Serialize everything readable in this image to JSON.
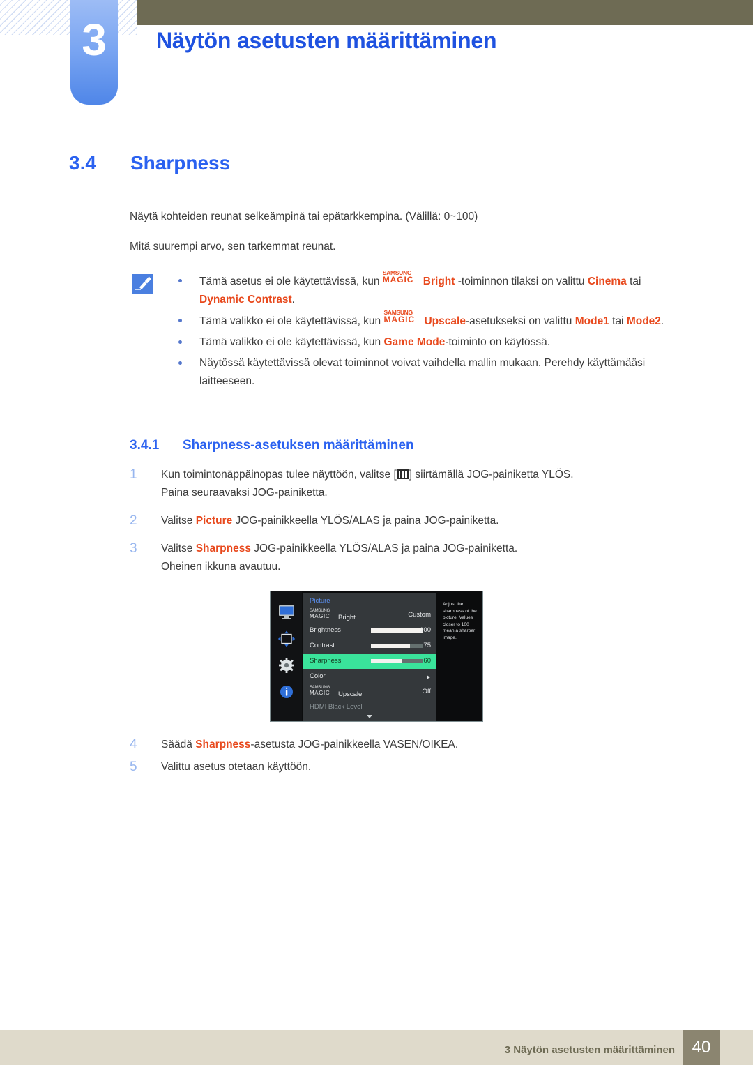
{
  "header": {
    "chapter_number": "3",
    "chapter_title": "Näytön asetusten määrittäminen",
    "hatch_icon": "diagonal-hatch-decoration",
    "olive_color": "#6e6b54",
    "tab_color": "#4f86e8"
  },
  "section": {
    "number": "3.4",
    "title": "Sharpness",
    "intro_1": "Näytä kohteiden reunat selkeämpinä tai epätarkkempina. (Välillä: 0~100)",
    "intro_2": "Mitä suurempi arvo, sen tarkemmat reunat."
  },
  "note": {
    "icon": "note-pen-icon",
    "bullets": [
      {
        "pre": "Tämä asetus ei ole käytettävissä, kun ",
        "magic_top": "SAMSUNG",
        "magic_bottom": "MAGIC",
        "brand_word": "Bright",
        "mid": " -toiminnon tilaksi on valittu ",
        "hl1": "Cinema",
        "conj": " tai ",
        "hl2": "Dynamic Contrast",
        "post": "."
      },
      {
        "pre": "Tämä valikko ei ole käytettävissä, kun ",
        "magic_top": "SAMSUNG",
        "magic_bottom": "MAGIC",
        "brand_word": "Upscale",
        "mid": "-asetukseksi on valittu ",
        "hl1": "Mode1",
        "conj": " tai ",
        "hl2": "Mode2",
        "post": "."
      },
      {
        "pre": "Tämä valikko ei ole käytettävissä, kun ",
        "hl1": "Game Mode",
        "post": "-toiminto on käytössä."
      },
      {
        "pre": "Näytössä käytettävissä olevat toiminnot voivat vaihdella mallin mukaan. Perehdy käyttämääsi laitteeseen."
      }
    ]
  },
  "subsection": {
    "number": "3.4.1",
    "title": "Sharpness-asetuksen määrittäminen",
    "steps": [
      {
        "n": "1",
        "text_a": "Kun toimintonäppäinopas tulee näyttöön, valitse [",
        "glyph": "menu-bars-icon",
        "text_b": "] siirtämällä JOG-painiketta YLÖS.",
        "sub": "Paina seuraavaksi JOG-painiketta."
      },
      {
        "n": "2",
        "text_a": "Valitse ",
        "hl": "Picture",
        "text_b": " JOG-painikkeella YLÖS/ALAS ja paina JOG-painiketta."
      },
      {
        "n": "3",
        "text_a": "Valitse ",
        "hl": "Sharpness",
        "text_b": " JOG-painikkeella YLÖS/ALAS ja paina JOG-painiketta.",
        "sub": "Oheinen ikkuna avautuu."
      },
      {
        "n": "4",
        "text_a": "Säädä ",
        "hl": "Sharpness",
        "text_b": "-asetusta JOG-painikkeella VASEN/OIKEA."
      },
      {
        "n": "5",
        "text_a": "Valittu asetus otetaan käyttöön."
      }
    ]
  },
  "osd": {
    "title": "Picture",
    "rail_icons": [
      "monitor-icon",
      "move-arrows-icon",
      "gear-icon",
      "info-icon"
    ],
    "highlight_color": "#3ae39b",
    "rows": [
      {
        "label_magic_top": "SAMSUNG",
        "label_magic_bottom": "MAGIC",
        "label": "Bright",
        "value": "Custom",
        "type": "value"
      },
      {
        "label": "Brightness",
        "value": "100",
        "type": "slider",
        "percent": 100
      },
      {
        "label": "Contrast",
        "value": "75",
        "type": "slider",
        "percent": 75
      },
      {
        "label": "Sharpness",
        "value": "60",
        "type": "slider",
        "percent": 60,
        "selected": true
      },
      {
        "label": "Color",
        "value": "",
        "type": "submenu"
      },
      {
        "label_magic_top": "SAMSUNG",
        "label_magic_bottom": "MAGIC",
        "label": "Upscale",
        "value": "Off",
        "type": "value"
      },
      {
        "label": "HDMI Black Level",
        "value": "",
        "type": "dim"
      }
    ],
    "help_text": "Adjust the sharpness of the picture. Values closer to 100 mean a sharper image.",
    "scroll_down_icon": "chevron-down-icon"
  },
  "footer": {
    "text": "3 Näytön asetusten määrittäminen",
    "page_number": "40"
  }
}
